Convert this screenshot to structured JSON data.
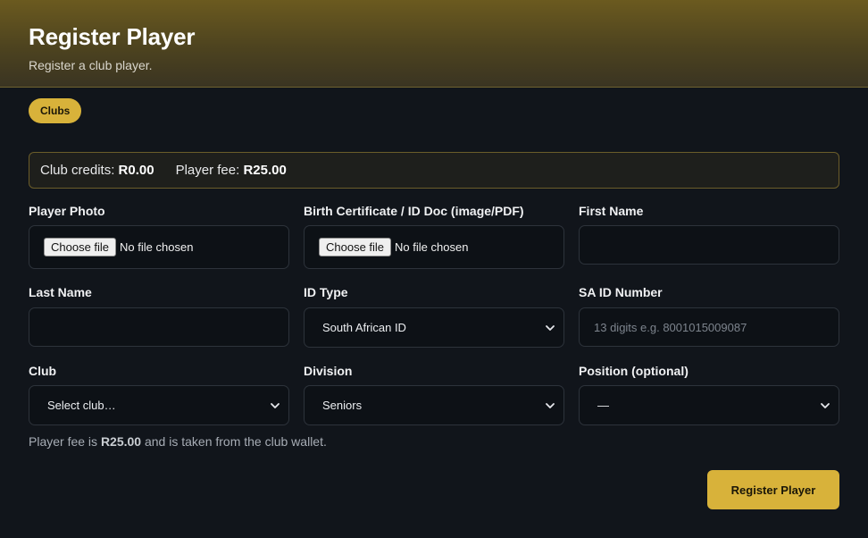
{
  "header": {
    "title": "Register Player",
    "subtitle": "Register a club player."
  },
  "nav": {
    "clubs_label": "Clubs"
  },
  "credits": {
    "club_credits_label": "Club credits:",
    "club_credits_value": "R0.00",
    "player_fee_label": "Player fee:",
    "player_fee_value": "R25.00"
  },
  "form": {
    "player_photo": {
      "label": "Player Photo",
      "button": "Choose file",
      "status": "No file chosen"
    },
    "birth_doc": {
      "label": "Birth Certificate / ID Doc (image/PDF)",
      "button": "Choose file",
      "status": "No file chosen"
    },
    "first_name": {
      "label": "First Name",
      "value": "",
      "placeholder": ""
    },
    "last_name": {
      "label": "Last Name",
      "value": "",
      "placeholder": ""
    },
    "id_type": {
      "label": "ID Type",
      "selected": "South African ID"
    },
    "sa_id_number": {
      "label": "SA ID Number",
      "value": "",
      "placeholder": "13 digits e.g. 8001015009087"
    },
    "club": {
      "label": "Club",
      "selected": "Select club…"
    },
    "division": {
      "label": "Division",
      "selected": "Seniors"
    },
    "position": {
      "label": "Position (optional)",
      "selected": "—"
    }
  },
  "note": {
    "prefix": "Player fee is",
    "amount": "R25.00",
    "suffix": "and is taken from the club wallet."
  },
  "actions": {
    "submit_label": "Register Player"
  },
  "colors": {
    "accent": "#d8b23a",
    "background": "#11151b",
    "field_background": "#0d1116",
    "field_border": "#2d333b"
  },
  "icons": {
    "select_arrow": "chevron-down-icon"
  }
}
